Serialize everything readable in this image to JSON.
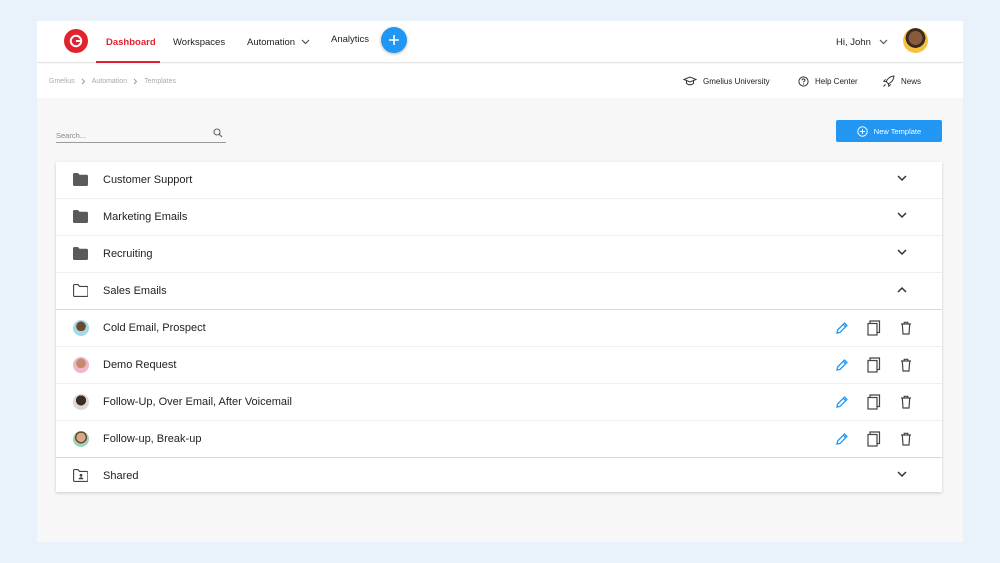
{
  "nav": {
    "items": [
      {
        "label": "Dashboard",
        "active": true
      },
      {
        "label": "Workspaces"
      },
      {
        "label": "Automation",
        "has_dropdown": true
      },
      {
        "label": "Analytics"
      }
    ],
    "greeting": "Hi, John"
  },
  "breadcrumb": [
    "Gmelius",
    "Automation",
    "Templates"
  ],
  "subnav": {
    "university": "Gmelius University",
    "help": "Help Center",
    "news": "News"
  },
  "search": {
    "placeholder": "Search..."
  },
  "new_template_label": "New Template",
  "folders": {
    "customer_support": "Customer Support",
    "marketing": "Marketing Emails",
    "recruiting": "Recruiting",
    "sales": "Sales Emails",
    "shared": "Shared"
  },
  "templates": [
    {
      "name": "Cold Email, Prospect"
    },
    {
      "name": "Demo Request"
    },
    {
      "name": "Follow-Up, Over Email, After Voicemail"
    },
    {
      "name": "Follow-up, Break-up"
    }
  ],
  "colors": {
    "brand_red": "#e2232e",
    "accent_blue": "#2196f3",
    "edit_icon": "#2196f3",
    "background": "#e9f1fb"
  }
}
